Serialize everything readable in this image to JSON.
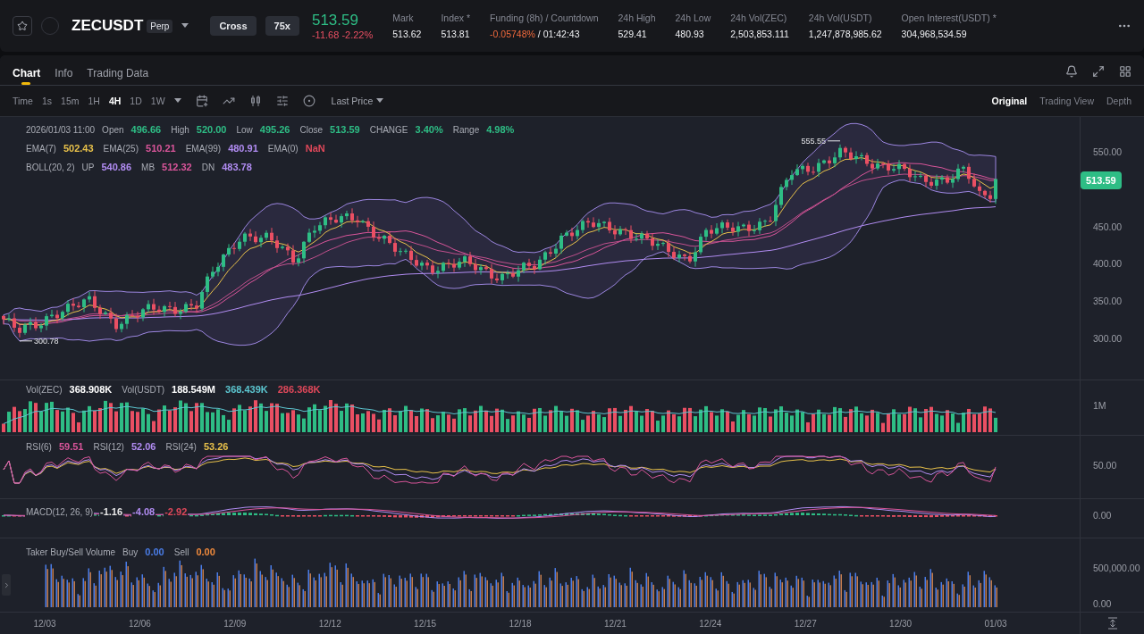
{
  "header": {
    "symbol": "ZECUSDT",
    "contract_badge": "Perp",
    "margin_mode": "Cross",
    "leverage": "75x",
    "last_price": "513.59",
    "change": "-11.68",
    "change_percent": "-2.22%",
    "stats": [
      {
        "kind": "plain",
        "label": "Mark",
        "value": "513.62"
      },
      {
        "kind": "plain",
        "label": "Index",
        "note": "*",
        "value": "513.81"
      },
      {
        "kind": "funding",
        "label": "Funding (8h) / Countdown",
        "value": "-0.05748%",
        "countdown": "/ 01:42:43"
      },
      {
        "kind": "plain",
        "label": "24h High",
        "value": "529.41"
      },
      {
        "kind": "plain",
        "label": "24h Low",
        "value": "480.93"
      },
      {
        "kind": "plain",
        "label": "24h Vol(ZEC)",
        "value": "2,503,853.111"
      },
      {
        "kind": "plain",
        "label": "24h Vol(USDT)",
        "value": "1,247,878,985.62"
      },
      {
        "kind": "plain",
        "label": "Open Interest(USDT)",
        "note": "*",
        "value": "304,968,534.59"
      }
    ]
  },
  "tabs": [
    {
      "label": "Chart",
      "selected": true
    },
    {
      "label": "Info",
      "selected": false
    },
    {
      "label": "Trading Data",
      "selected": false
    }
  ],
  "toolbar": {
    "intervals": [
      {
        "label": "Time",
        "selected": false
      },
      {
        "label": "1s",
        "selected": false
      },
      {
        "label": "15m",
        "selected": false
      },
      {
        "label": "1H",
        "selected": false
      },
      {
        "label": "4H",
        "selected": true
      },
      {
        "label": "1D",
        "selected": false
      },
      {
        "label": "1W",
        "selected": false
      }
    ],
    "price_type": "Last Price",
    "views": [
      {
        "label": "Original",
        "selected": true
      },
      {
        "label": "Trading View",
        "selected": false
      },
      {
        "label": "Depth",
        "selected": false
      }
    ]
  },
  "main_pane": {
    "datetime": "2026/01/03 11:00",
    "ohlc": [
      {
        "label": "Open",
        "value": "496.66"
      },
      {
        "label": "High",
        "value": "520.00"
      },
      {
        "label": "Low",
        "value": "495.26"
      },
      {
        "label": "Close",
        "value": "513.59"
      },
      {
        "label": "CHANGE",
        "value": "3.40%"
      },
      {
        "label": "Range",
        "value": "4.98%"
      }
    ],
    "ema": [
      {
        "label": "EMA(7)",
        "value": "502.43",
        "color": "#e8c14a"
      },
      {
        "label": "EMA(25)",
        "value": "510.21",
        "color": "#d9559a"
      },
      {
        "label": "EMA(99)",
        "value": "480.91",
        "color": "#b18cf2"
      },
      {
        "label": "EMA(0)",
        "value": "NaN",
        "color": "#e0485a"
      }
    ],
    "boll_title": "BOLL(20, 2)",
    "boll": [
      {
        "label": "UP",
        "value": "540.86",
        "color": "#b18cf2"
      },
      {
        "label": "MB",
        "value": "512.32",
        "color": "#d9559a"
      },
      {
        "label": "DN",
        "value": "483.78",
        "color": "#b18cf2"
      }
    ],
    "axis": [
      "550.00",
      "450.00",
      "400.00",
      "350.00",
      "300.00"
    ],
    "current_price": "513.59",
    "high_marker": "555.55",
    "low_marker": "300.78"
  },
  "volume_pane": {
    "items": [
      {
        "label": "Vol(ZEC)",
        "value": "368.908K",
        "color": "#ffffff"
      },
      {
        "label": "Vol(USDT)",
        "value": "188.549M",
        "color": "#ffffff"
      },
      {
        "value": "368.439K",
        "color": "#5cc6d0"
      },
      {
        "value": "286.368K",
        "color": "#e0485a"
      }
    ],
    "axis": [
      "1M"
    ]
  },
  "rsi_pane": {
    "items": [
      {
        "label": "RSI(6)",
        "value": "59.51",
        "color": "#d9559a"
      },
      {
        "label": "RSI(12)",
        "value": "52.06",
        "color": "#b18cf2"
      },
      {
        "label": "RSI(24)",
        "value": "53.26",
        "color": "#e8c14a"
      }
    ],
    "axis": [
      "50.00"
    ]
  },
  "macd_pane": {
    "title": "MACD(12, 26, 9)",
    "items": [
      {
        "value": "-1.16",
        "color": "#e8e8e8"
      },
      {
        "value": "-4.08",
        "color": "#b18cf2"
      },
      {
        "value": "-2.92",
        "color": "#e0485a"
      }
    ],
    "axis": [
      "0.00"
    ]
  },
  "taker_pane": {
    "title": "Taker Buy/Sell Volume",
    "items": [
      {
        "label": "Buy",
        "value": "0.00",
        "color": "#4a7de8"
      },
      {
        "label": "Sell",
        "value": "0.00",
        "color": "#f08a3c"
      }
    ],
    "axis": [
      "500,000.00",
      "0.00"
    ]
  },
  "x_axis": [
    "12/03",
    "12/06",
    "12/09",
    "12/12",
    "12/15",
    "12/18",
    "12/21",
    "12/24",
    "12/27",
    "12/30",
    "01/03"
  ]
}
